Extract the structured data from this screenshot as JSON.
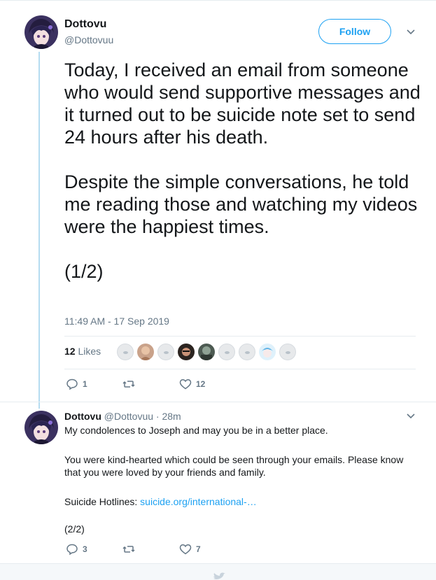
{
  "main_tweet": {
    "author_name": "Dottovu",
    "author_handle": "@Dottovuu",
    "follow_label": "Follow",
    "text": "Today, I received an email from someone who would send supportive messages and it turned out to be suicide note set to send 24 hours after his death.\n\nDespite the simple conversations, he told me reading those and watching my videos were the happiest times.\n\n(1/2)",
    "timestamp": "11:49 AM - 17 Sep 2019",
    "likes_number": "12",
    "likes_label": "Likes",
    "reply_count": "1",
    "like_count": "12"
  },
  "reply_tweet": {
    "author_name": "Dottovu",
    "author_handle": "@Dottovuu",
    "time_ago": "· 28m",
    "line1": "My condolences to Joseph and may you be in a better place.",
    "line2": "You were kind-hearted which could be seen through your emails. Please know that you were loved by your friends and family.",
    "hotline_label": "Suicide Hotlines: ",
    "hotline_link": "suicide.org/international-…",
    "part": "(2/2)",
    "reply_count": "3",
    "like_count": "7"
  },
  "colors": {
    "accent": "#1da1f2",
    "thread_line": "#b5dcf1",
    "muted": "#657786",
    "text": "#14171a"
  },
  "icons": {
    "reply": "speech-bubble-icon",
    "retweet": "retweet-icon",
    "like": "heart-icon",
    "caret": "chevron-down-icon",
    "bottom": "twitter-bird-icon"
  }
}
